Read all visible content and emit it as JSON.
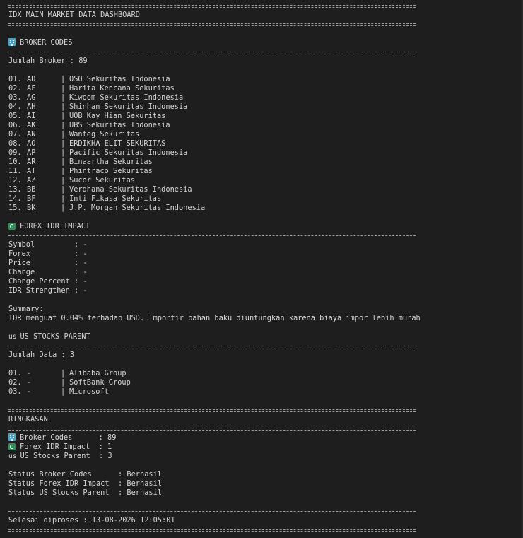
{
  "header": {
    "title": "IDX MAIN MARKET DATA DASHBOARD"
  },
  "broker_section": {
    "icon": "office-building-icon",
    "title": "BROKER CODES",
    "count_label": "Jumlah Broker",
    "count_value": "89",
    "rows": [
      {
        "no": "01.",
        "code": "AD",
        "name": "OSO Sekuritas Indonesia"
      },
      {
        "no": "02.",
        "code": "AF",
        "name": "Harita Kencana Sekuritas"
      },
      {
        "no": "03.",
        "code": "AG",
        "name": "Kiwoom Sekuritas Indonesia"
      },
      {
        "no": "04.",
        "code": "AH",
        "name": "Shinhan Sekuritas Indonesia"
      },
      {
        "no": "05.",
        "code": "AI",
        "name": "UOB Kay Hian Sekuritas"
      },
      {
        "no": "06.",
        "code": "AK",
        "name": "UBS Sekuritas Indonesia"
      },
      {
        "no": "07.",
        "code": "AN",
        "name": "Wanteg Sekuritas"
      },
      {
        "no": "08.",
        "code": "AO",
        "name": "ERDIKHA ELIT SEKURITAS"
      },
      {
        "no": "09.",
        "code": "AP",
        "name": "Pacific Sekuritas Indonesia"
      },
      {
        "no": "10.",
        "code": "AR",
        "name": "Binaartha Sekuritas"
      },
      {
        "no": "11.",
        "code": "AT",
        "name": "Phintraco Sekuritas"
      },
      {
        "no": "12.",
        "code": "AZ",
        "name": "Sucor Sekuritas"
      },
      {
        "no": "13.",
        "code": "BB",
        "name": "Verdhana Sekuritas Indonesia"
      },
      {
        "no": "14.",
        "code": "BF",
        "name": "Inti Fikasa Sekuritas"
      },
      {
        "no": "15.",
        "code": "BK",
        "name": "J.P. Morgan Sekuritas Indonesia"
      }
    ]
  },
  "forex_section": {
    "icon": "exchange-arrows-icon",
    "title": "FOREX IDR IMPACT",
    "fields": [
      {
        "label": "Symbol        ",
        "value": "-"
      },
      {
        "label": "Forex         ",
        "value": "-"
      },
      {
        "label": "Price         ",
        "value": "-"
      },
      {
        "label": "Change        ",
        "value": "-"
      },
      {
        "label": "Change Percent",
        "value": "-"
      },
      {
        "label": "IDR Strengthen",
        "value": "-"
      }
    ],
    "summary_label": "Summary:",
    "summary_text": "IDR menguat 0.04% terhadap USD. Importir bahan baku diuntungkan karena biaya impor lebih murah"
  },
  "us_section": {
    "icon": "us-flag-icon",
    "flag_text": "us",
    "title": "US STOCKS PARENT",
    "count_label": "Jumlah Data",
    "count_value": "3",
    "rows": [
      {
        "no": "01.",
        "code": "-",
        "name": "Alibaba Group"
      },
      {
        "no": "02.",
        "code": "-",
        "name": "SoftBank Group"
      },
      {
        "no": "03.",
        "code": "-",
        "name": "Microsoft"
      }
    ]
  },
  "summary_section": {
    "title": "RINGKASAN",
    "broker_label": "Broker Codes      ",
    "broker_value": "89",
    "forex_label": "Forex IDR Impact  ",
    "forex_value": "1",
    "us_flag_text": "us",
    "us_label": "US Stocks Parent  ",
    "us_value": "3",
    "statuses": [
      {
        "label": "Status Broker Codes     ",
        "value": "Berhasil"
      },
      {
        "label": "Status Forex IDR Impact ",
        "value": "Berhasil"
      },
      {
        "label": "Status US Stocks Parent ",
        "value": "Berhasil"
      }
    ]
  },
  "footer": {
    "processed_label": "Selesai diproses",
    "processed_value": "13-08-2026 12:05:01"
  },
  "colors": {
    "background": "#1e1e1e",
    "text": "#d4d4d4",
    "rule": "#9a9a9a"
  }
}
